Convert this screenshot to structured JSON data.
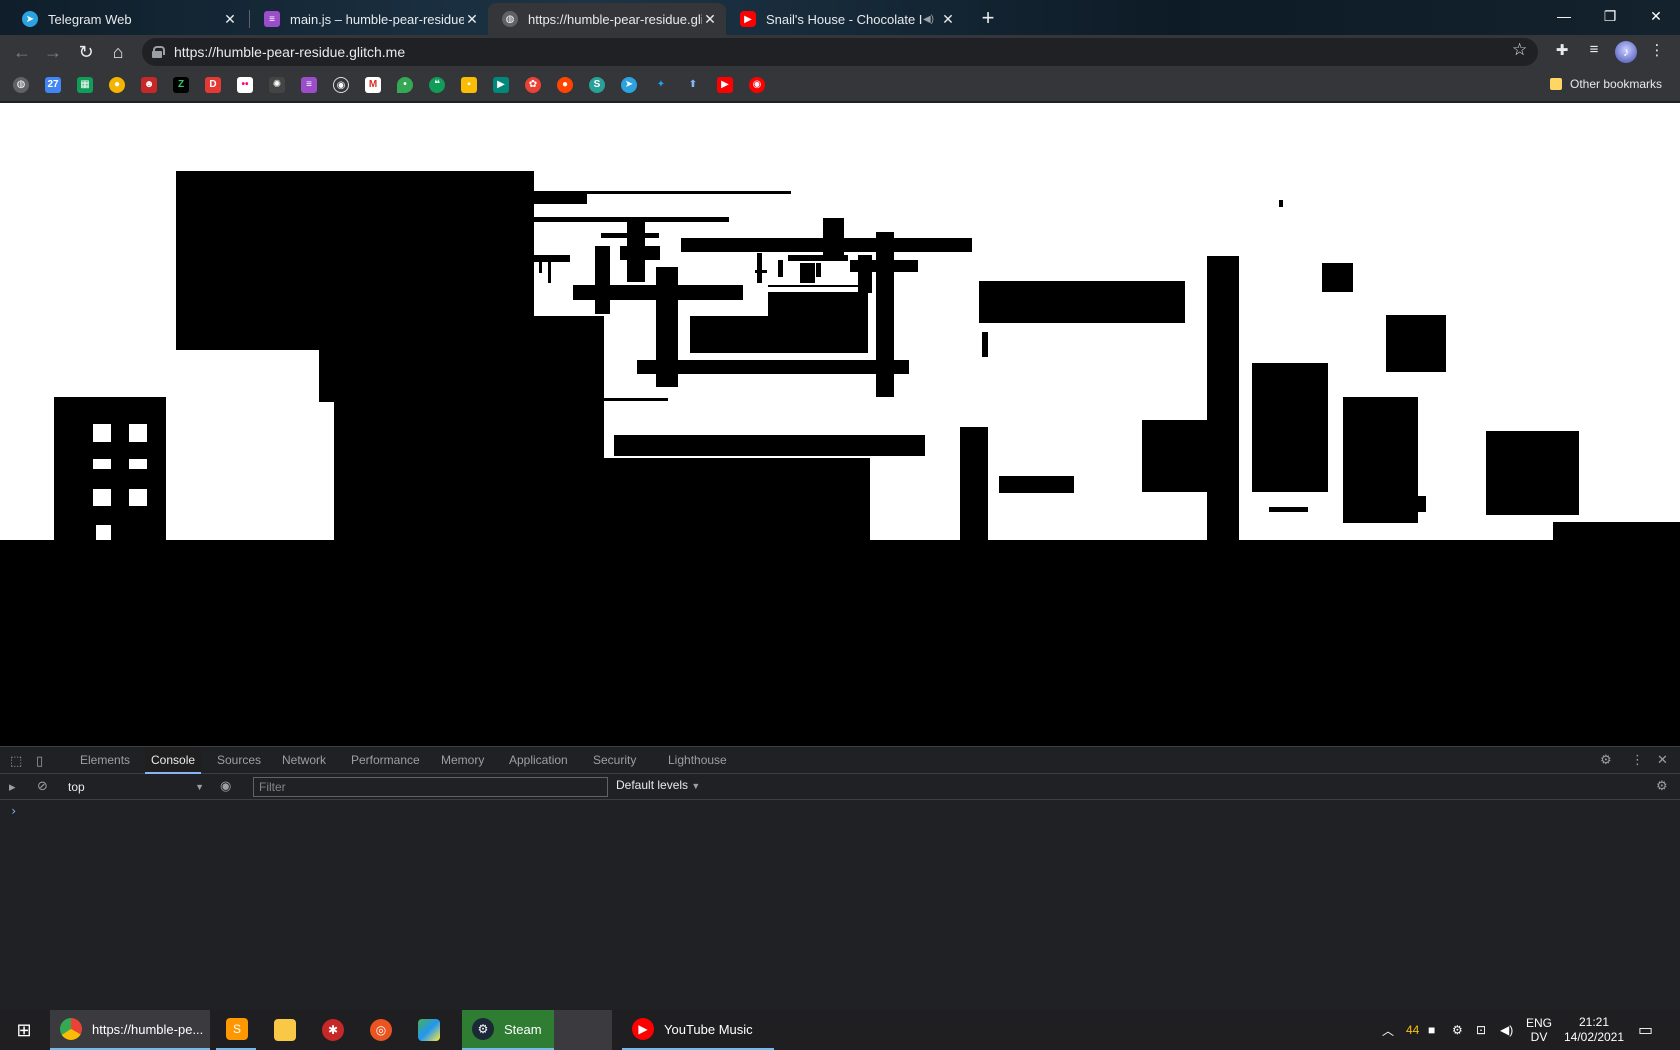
{
  "browser": {
    "tabs": [
      {
        "title": "Telegram Web",
        "icon": "telegram-icon",
        "active": false
      },
      {
        "title": "main.js – humble-pear-residue",
        "icon": "glitch-icon",
        "active": false
      },
      {
        "title": "https://humble-pear-residue.glitc",
        "icon": "globe-icon",
        "active": true
      },
      {
        "title": "Snail's House - Chocolate Isla",
        "icon": "youtube-icon",
        "active": false
      }
    ],
    "new_tab_label": "+",
    "window_controls": {
      "minimize": "—",
      "restore": "❐",
      "close": "✕"
    },
    "address_url": "https://humble-pear-residue.glitch.me",
    "bookmarks_other_label": "Other bookmarks"
  },
  "devtools": {
    "tabs": [
      "Elements",
      "Console",
      "Sources",
      "Network",
      "Performance",
      "Memory",
      "Application",
      "Security",
      "Lighthouse"
    ],
    "active_tab": "Console",
    "context": "top",
    "filter_placeholder": "Filter",
    "levels_label": "Default levels",
    "levels_arrow": "▼",
    "prompt_symbol": "›"
  },
  "taskbar": {
    "apps": [
      {
        "label": "https://humble-pe...",
        "icon": "chrome-icon"
      },
      {
        "label": "",
        "icon": "sublime-text-icon"
      },
      {
        "label": "",
        "icon": "file-explorer-icon"
      },
      {
        "label": "",
        "icon": "red-app-icon"
      },
      {
        "label": "",
        "icon": "ubuntu-icon"
      },
      {
        "label": "",
        "icon": "paint-icon"
      },
      {
        "label": "Steam",
        "icon": "steam-icon"
      },
      {
        "label": "YouTube Music",
        "icon": "youtube-music-icon"
      }
    ],
    "tray_count": "44",
    "language_line1": "ENG",
    "language_line2": "DV",
    "time": "21:21",
    "date": "14/02/2021"
  },
  "colors": {
    "chrome_bg": "#35363a",
    "devtools_bg": "#202124",
    "canvas_bg": "#ffffff",
    "canvas_ink": "#000000",
    "accent": "#8ab4f8"
  }
}
